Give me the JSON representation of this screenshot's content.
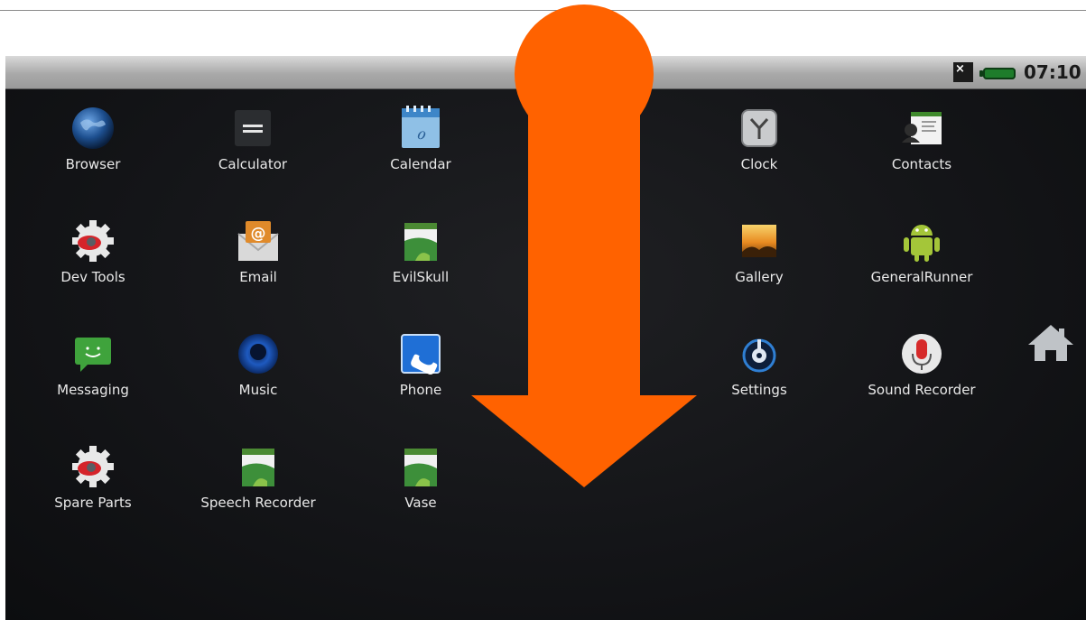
{
  "status_bar": {
    "notification": "×",
    "time": "07:10"
  },
  "apps": [
    {
      "label": "Browser",
      "icon": "globe-icon"
    },
    {
      "label": "Calculator",
      "icon": "calculator-icon"
    },
    {
      "label": "Calendar",
      "icon": "calendar-icon"
    },
    {
      "label": "Clock",
      "icon": "clock-icon"
    },
    {
      "label": "Contacts",
      "icon": "contacts-icon"
    },
    {
      "label": "Dev Tools",
      "icon": "gear-icon"
    },
    {
      "label": "Email",
      "icon": "email-icon"
    },
    {
      "label": "EvilSkull",
      "icon": "android-app-icon"
    },
    {
      "label": "Gallery",
      "icon": "gallery-icon"
    },
    {
      "label": "GeneralRunner",
      "icon": "android-robot-icon"
    },
    {
      "label": "Messaging",
      "icon": "message-icon"
    },
    {
      "label": "Music",
      "icon": "music-icon"
    },
    {
      "label": "Phone",
      "icon": "phone-icon"
    },
    {
      "label": "Settings",
      "icon": "settings-icon"
    },
    {
      "label": "Sound Recorder",
      "icon": "microphone-icon"
    },
    {
      "label": "Spare Parts",
      "icon": "gear-icon"
    },
    {
      "label": "Speech Recorder",
      "icon": "android-app-icon"
    },
    {
      "label": "Vase",
      "icon": "android-app-icon"
    }
  ],
  "home": {
    "icon": "home-icon"
  },
  "overlay": {
    "icon": "swipe-down-arrow-icon",
    "color": "#ff6200"
  }
}
